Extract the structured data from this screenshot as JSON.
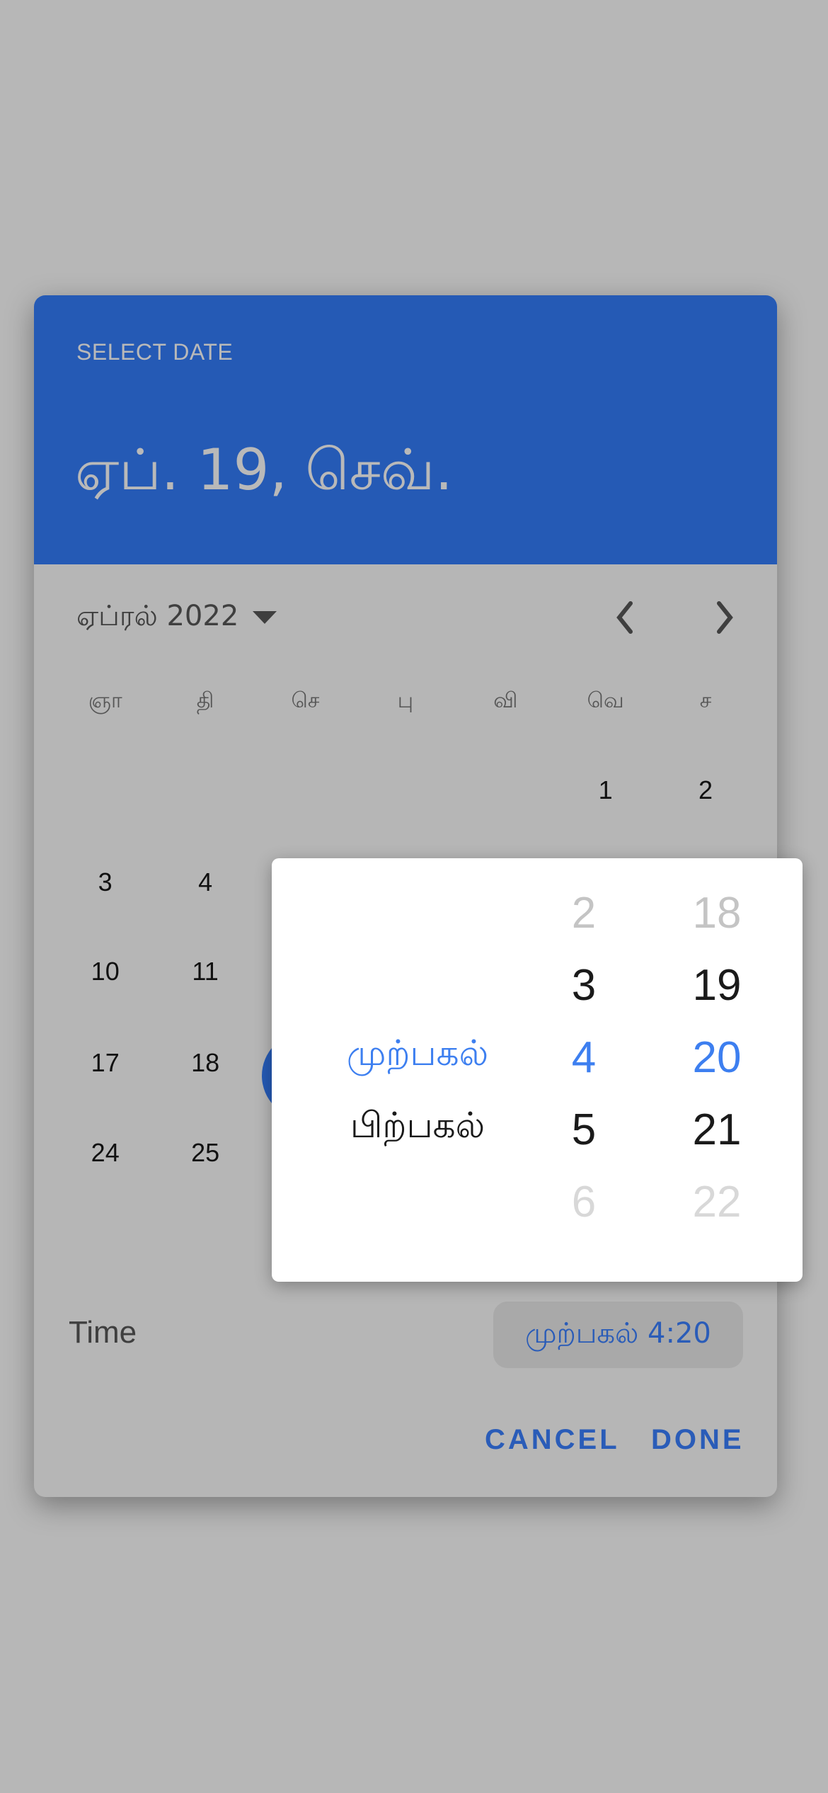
{
  "header": {
    "label": "SELECT DATE",
    "selected_date": "ஏப். 19, செவ்.",
    "background": "#255ab5"
  },
  "calendar": {
    "month_label": "ஏப்ரல் 2022",
    "weekdays": [
      "ஞா",
      "தி",
      "செ",
      "பு",
      "வி",
      "வெ",
      "ச"
    ],
    "weeks": [
      [
        "",
        "",
        "",
        "",
        "",
        "1",
        "2"
      ],
      [
        "3",
        "4",
        "",
        "",
        "",
        "",
        ""
      ],
      [
        "10",
        "11",
        "",
        "",
        "",
        "",
        ""
      ],
      [
        "17",
        "18",
        "",
        "",
        "",
        "",
        ""
      ],
      [
        "24",
        "25",
        "",
        "",
        "",
        "",
        ""
      ]
    ],
    "selected_day": "19"
  },
  "time": {
    "label": "Time",
    "value": "முற்பகல் 4:20"
  },
  "actions": {
    "cancel": "CANCEL",
    "done": "DONE"
  },
  "picker": {
    "ampm": [
      "முற்பகல்",
      "பிற்பகல்"
    ],
    "hours": [
      "2",
      "3",
      "4",
      "5",
      "6"
    ],
    "minutes": [
      "18",
      "19",
      "20",
      "21",
      "22"
    ],
    "selected": {
      "ampm": "முற்பகல்",
      "hour": "4",
      "minute": "20"
    },
    "accent": "#3d7ff0"
  }
}
